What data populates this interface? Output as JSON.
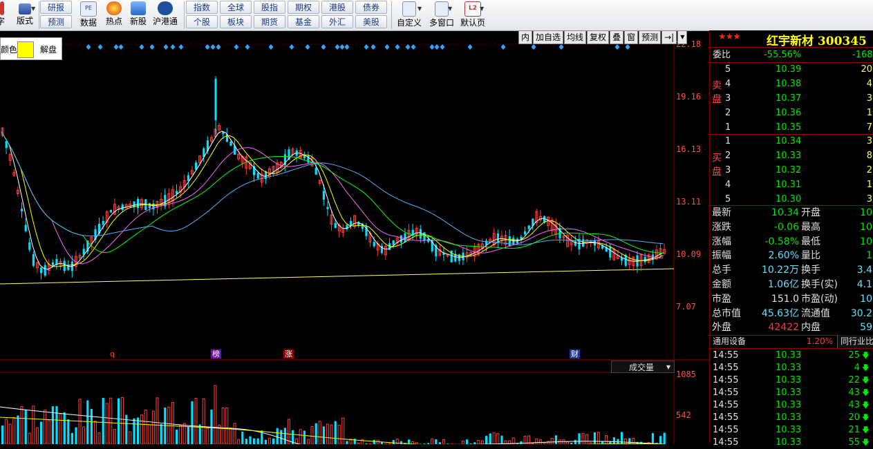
{
  "toolbar": {
    "left_label": "版式",
    "cut_label": "字",
    "btn_research": "研报",
    "btn_forecast": "预测",
    "btn_data": "数据",
    "btn_hot": "热点",
    "btn_newstock": "新股",
    "btn_hk": "沪港通",
    "index": [
      "指数",
      "全球",
      "股指",
      "期权",
      "港股",
      "债券"
    ],
    "market": [
      "个股",
      "板块",
      "期货",
      "基金",
      "外汇",
      "美股"
    ],
    "custom": "自定义",
    "multi_window": "多窗口",
    "default": "默认页"
  },
  "chart": {
    "tabs": [
      "内",
      "加自选",
      "均线",
      "复权",
      "叠",
      "窗",
      "预测"
    ],
    "price_ticks": [
      "22.18",
      "19.16",
      "16.13",
      "13.11",
      "10.09",
      "7.07"
    ],
    "volume_ticks": [
      "1085",
      "542"
    ],
    "volume_selector": "成交量",
    "markers": [
      {
        "label": "q",
        "color": "#ff4040"
      },
      {
        "label": "榜",
        "color": "#ffffff",
        "bg": "#6a0dad"
      },
      {
        "label": "涨",
        "color": "#ffffff",
        "bg": "#8b0000"
      },
      {
        "label": "财",
        "color": "#ffffff",
        "bg": "#1e3a9a"
      }
    ],
    "popup": {
      "color_label": "颜色",
      "unlock": "解盘",
      "swatch": "#ffff00"
    }
  },
  "quote": {
    "stock_name": "红宇新材 300345",
    "stars": "★★★",
    "webi_label": "委比",
    "webi_value": "-55.56%",
    "webi_diff": "-168",
    "sell_side": "卖盘",
    "buy_side": "买盘",
    "sell": [
      {
        "level": "5",
        "price": "10.39",
        "vol": "20"
      },
      {
        "level": "4",
        "price": "10.38",
        "vol": "4"
      },
      {
        "level": "3",
        "price": "10.37",
        "vol": "3"
      },
      {
        "level": "2",
        "price": "10.36",
        "vol": "1"
      },
      {
        "level": "1",
        "price": "10.35",
        "vol": "7"
      }
    ],
    "buy": [
      {
        "level": "1",
        "price": "10.34",
        "vol": "3"
      },
      {
        "level": "2",
        "price": "10.33",
        "vol": "8"
      },
      {
        "level": "3",
        "price": "10.32",
        "vol": "2"
      },
      {
        "level": "4",
        "price": "10.31",
        "vol": "1"
      },
      {
        "level": "5",
        "price": "10.30",
        "vol": "3"
      }
    ],
    "stats": [
      {
        "k1": "最新",
        "v1": "10.34",
        "k2": "开盘",
        "v2": "10"
      },
      {
        "k1": "涨跌",
        "v1": "-0.06",
        "k2": "最高",
        "v2": "10"
      },
      {
        "k1": "涨幅",
        "v1": "-0.58%",
        "k2": "最低",
        "v2": "10"
      },
      {
        "k1": "振幅",
        "v1": "2.60%",
        "k2": "量比",
        "v2": "1"
      },
      {
        "k1": "总手",
        "v1": "10.22万",
        "k2": "换手",
        "v2": "3.4"
      },
      {
        "k1": "金额",
        "v1": "1.06亿",
        "k2": "换手(实)",
        "v2": "4.1"
      },
      {
        "k1": "市盈",
        "v1": "151.0",
        "k2": "市盈(动)",
        "v2": "10"
      },
      {
        "k1": "总市值",
        "v1": "45.63亿",
        "k2": "流通值",
        "v2": "30.2"
      },
      {
        "k1": "外盘",
        "v1": "42422",
        "k2": "内盘",
        "v2": "59"
      }
    ],
    "industry_label": "通用设备",
    "industry_pct": "1.20%",
    "industry_compare": "同行业比",
    "ticks": [
      {
        "time": "14:55",
        "price": "10.33",
        "vol": "25"
      },
      {
        "time": "14:55",
        "price": "10.33",
        "vol": "4"
      },
      {
        "time": "14:55",
        "price": "10.33",
        "vol": "22"
      },
      {
        "time": "14:55",
        "price": "10.33",
        "vol": "43"
      },
      {
        "time": "14:55",
        "price": "10.33",
        "vol": "43"
      },
      {
        "time": "14:55",
        "price": "10.33",
        "vol": "20"
      },
      {
        "time": "14:55",
        "price": "10.33",
        "vol": "21"
      },
      {
        "time": "14:55",
        "price": "10.33",
        "vol": "55"
      }
    ]
  },
  "colors": {
    "up": "#ff3b3b",
    "down": "#00e0ff",
    "ma5": "#ffffff",
    "ma10": "#ffff00",
    "ma20": "#ff66ff",
    "ma30": "#00ff00",
    "ma60": "#4fb0ff"
  }
}
